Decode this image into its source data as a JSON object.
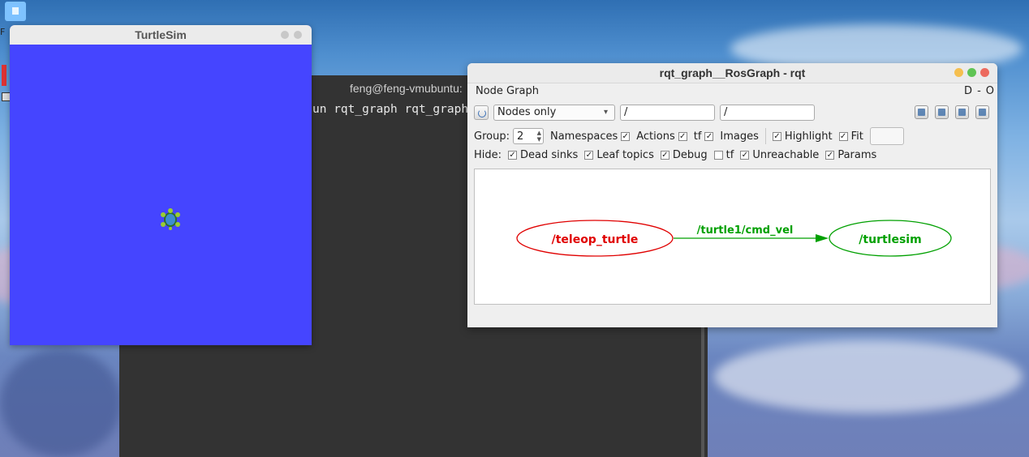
{
  "desktop": {
    "corner_letter": "F"
  },
  "terminal": {
    "title": "feng@feng-vmubuntu:",
    "command_line": "un rqt_graph rqt_graph"
  },
  "turtlesim": {
    "title": "TurtleSim",
    "bg_color": "#4545ff"
  },
  "rqt": {
    "title": "rqt_graph__RosGraph - rqt",
    "plugin_title": "Node Graph",
    "plugin_controls": [
      "D",
      "-",
      "O"
    ],
    "filter": {
      "mode": "Nodes only",
      "ns_filter": "/",
      "topic_filter": "/"
    },
    "group": {
      "label": "Group:",
      "value": "2"
    },
    "options": [
      {
        "label": "Namespaces",
        "checked": true
      },
      {
        "label": "Actions",
        "checked": true
      },
      {
        "label": "tf",
        "checked": true
      },
      {
        "label": "Images",
        "checked": true
      },
      {
        "label": "Highlight",
        "checked": true
      },
      {
        "label": "Fit",
        "checked": true
      }
    ],
    "hide": {
      "label": "Hide:",
      "items": [
        {
          "label": "Dead sinks",
          "checked": true
        },
        {
          "label": "Leaf topics",
          "checked": true
        },
        {
          "label": "Debug",
          "checked": true
        },
        {
          "label": "tf",
          "checked": false
        },
        {
          "label": "Unreachable",
          "checked": true
        },
        {
          "label": "Params",
          "checked": true
        }
      ]
    },
    "graph": {
      "source_node": "/teleop_turtle",
      "edge_topic": "/turtle1/cmd_vel",
      "target_node": "/turtlesim",
      "source_color": "#e00000",
      "edge_color": "#00a000"
    }
  }
}
